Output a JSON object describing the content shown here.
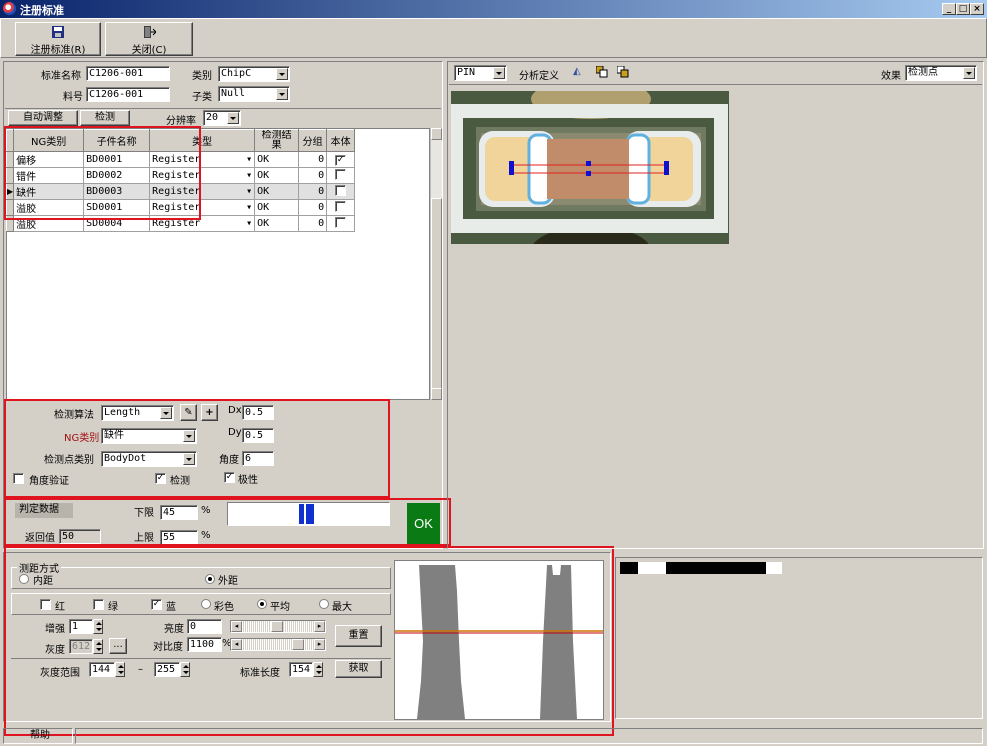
{
  "window": {
    "title": "注册标准"
  },
  "toolbar": {
    "register_label": "注册标准(R)",
    "close_label": "关闭(C)"
  },
  "header": {
    "std_name_label": "标准名称",
    "std_name_value": "C1206-001",
    "category_label": "类别",
    "category_value": "ChipC",
    "part_no_label": "料号",
    "part_no_value": "C1206-001",
    "subcategory_label": "子类",
    "subcategory_value": "Null"
  },
  "tabs": {
    "auto_adjust": "自动调整",
    "detect": "检测",
    "resolution_label": "分辨率",
    "resolution_value": "20"
  },
  "table": {
    "columns": [
      "NG类别",
      "子件名称",
      "类型",
      "检测结果",
      "分组",
      "本体"
    ],
    "rows": [
      {
        "ng": "偏移",
        "name": "BD0001",
        "type": "Register",
        "result": "OK",
        "group": "0",
        "body": "✓"
      },
      {
        "ng": "错件",
        "name": "BD0002",
        "type": "Register",
        "result": "OK",
        "group": "0",
        "body": ""
      },
      {
        "ng": "缺件",
        "name": "BD0003",
        "type": "Register",
        "result": "OK",
        "group": "0",
        "body": ""
      },
      {
        "ng": "溢胶",
        "name": "SD0001",
        "type": "Register",
        "result": "OK",
        "group": "0",
        "body": ""
      },
      {
        "ng": "溢胶",
        "name": "SD0004",
        "type": "Register",
        "result": "OK",
        "group": "0",
        "body": ""
      }
    ]
  },
  "algo": {
    "method_label": "检测算法",
    "method_value": "Length",
    "ng_label": "NG类别",
    "ng_value": "缺件",
    "point_label": "检测点类别",
    "point_value": "BodyDot",
    "dx_label": "Dx",
    "dx_value": "0.5",
    "dy_label": "Dy",
    "dy_value": "0.5",
    "angle_label": "角度",
    "angle_value": "6",
    "angle_verify_label": "角度验证",
    "detect_label": "检测",
    "polarity_label": "极性"
  },
  "judge": {
    "title": "判定数据",
    "return_label": "返回值",
    "return_value": "50",
    "lower_label": "下限",
    "lower_value": "45",
    "upper_label": "上限",
    "upper_value": "55",
    "unit": "%",
    "result": "OK",
    "colors": {
      "ok": "#0a7a14",
      "bar": "#1030d0"
    }
  },
  "measure": {
    "group_label": "测距方式",
    "inner_label": "内距",
    "outer_label": "外距",
    "red": "红",
    "green": "绿",
    "blue": "蓝",
    "color": "彩色",
    "avg": "平均",
    "max": "最大",
    "enhance_label": "增强",
    "enhance_value": "1",
    "gray_label": "灰度",
    "gray_value": "612",
    "brightness_label": "亮度",
    "brightness_value": "0",
    "contrast_label": "对比度",
    "contrast_value": "1100",
    "reset_label": "重置",
    "gray_range_label": "灰度范围",
    "gray_min": "144",
    "gray_max": "255",
    "dash": "–",
    "std_len_label": "标准长度",
    "std_len_value": "154",
    "capture_label": "获取",
    "pct": "%",
    "ellipsis": "..."
  },
  "right_toolbar": {
    "pin_value": "PIN",
    "analysis_label": "分析定义",
    "effect_label": "效果",
    "effect_value": "检测点"
  },
  "status": {
    "help": "帮助"
  }
}
